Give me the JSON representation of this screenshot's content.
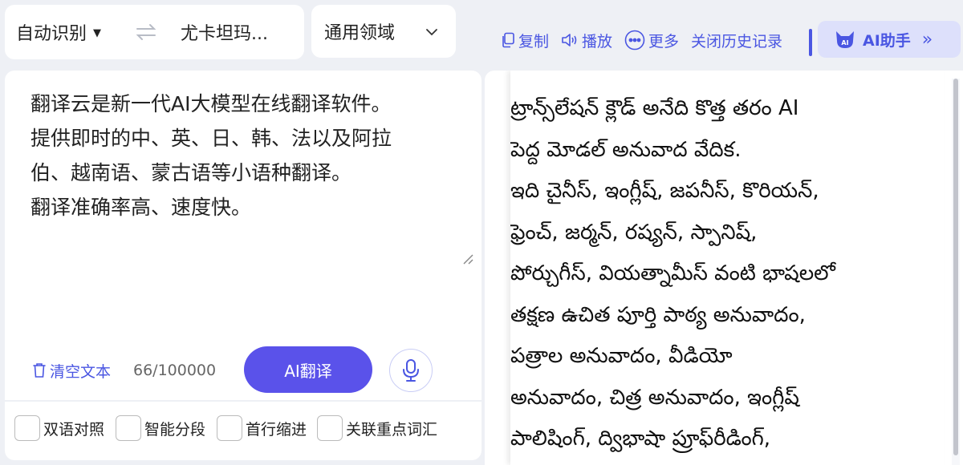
{
  "lang_bar": {
    "source_language": "自动识别",
    "target_language": "尤卡坦玛...",
    "domain": "通用领域"
  },
  "toolbar": {
    "copy": "复制",
    "play": "播放",
    "more": "更多",
    "close_history": "关闭历史记录",
    "ai_assistant": "AI助手",
    "ai_badge": "AI"
  },
  "source": {
    "lines": [
      "翻译云是新一代AI大模型在线翻译软件。",
      "提供即时的中、英、日、韩、法以及阿拉",
      "伯、越南语、蒙古语等小语种翻译。",
      "翻译准确率高、速度快。"
    ],
    "clear_text": "清空文本",
    "char_count": "66/100000",
    "translate_button": "AI翻译"
  },
  "options": {
    "bilingual": "双语对照",
    "smart_segment": "智能分段",
    "first_line_indent": "首行缩进",
    "related_keywords": "关联重点词汇"
  },
  "target": {
    "lines": [
      "ట్రాన్స్‌లేషన్ క్లౌడ్ అనేది కొత్త తరం AI",
      "పెద్ద మోడల్ అనువాద వేదిక.",
      "ఇది చైనీస్, ఇంగ్లీష్, జపనీస్, కొరియన్,",
      "ఫ్రెంచ్, జర్మన్, రష్యన్, స్పానిష్,",
      "పోర్చుగీస్, వియత్నామీస్ వంటి భాషలలో",
      "తక్షణ ఉచిత పూర్తి పాఠ్య అనువాదం,",
      "పత్రాల అనువాదం, వీడియో",
      "అనువాదం, చిత్ర అనువాదం, ఇంగ్లీష్",
      "పాలిషింగ్, ద్విభాషా ప్రూఫ్‌రీడింగ్,"
    ]
  },
  "colors": {
    "accent": "#4a56e2",
    "button": "#5a52ea",
    "background": "#eef0f5"
  }
}
